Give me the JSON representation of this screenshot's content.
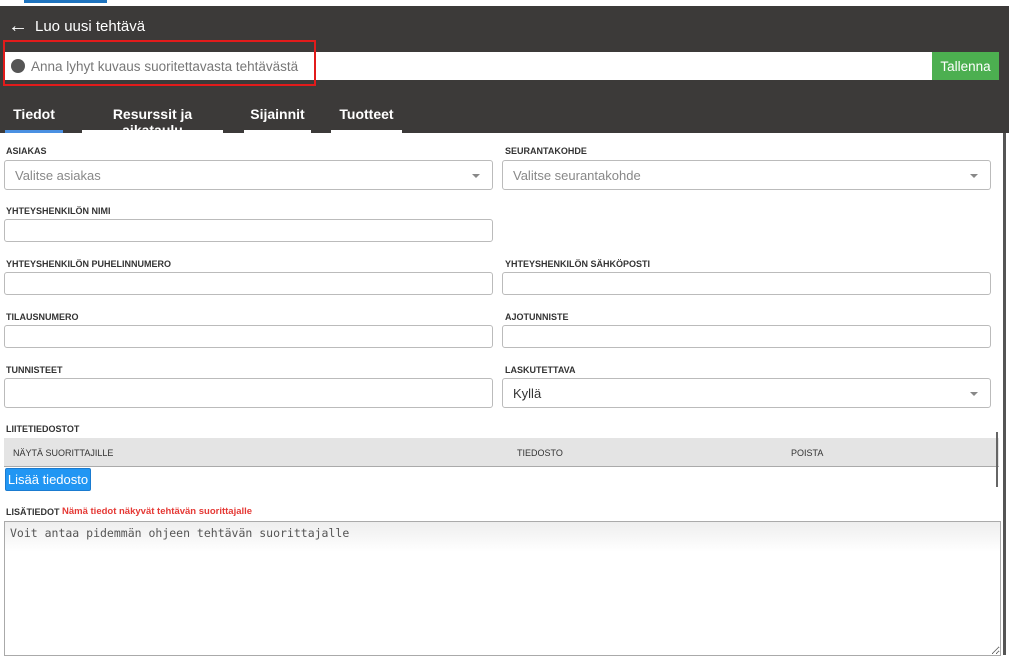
{
  "header": {
    "title": "Luo uusi tehtävä",
    "description_placeholder": "Anna lyhyt kuvaus suoritettavasta tehtävästä",
    "save_label": "Tallenna"
  },
  "tabs": [
    {
      "label": "Tiedot",
      "active": true
    },
    {
      "label": "Resurssit ja aikataulu"
    },
    {
      "label": "Sijainnit"
    },
    {
      "label": "Tuotteet"
    }
  ],
  "form": {
    "customer": {
      "label": "ASIAKAS",
      "placeholder": "Valitse asiakas"
    },
    "tracking": {
      "label": "SEURANTAKOHDE",
      "placeholder": "Valitse seurantakohde"
    },
    "contact_name": {
      "label": "YHTEYSHENKILÖN NIMI"
    },
    "contact_phone": {
      "label": "YHTEYSHENKILÖN PUHELINNUMERO"
    },
    "contact_email": {
      "label": "YHTEYSHENKILÖN SÄHKÖPOSTI"
    },
    "order_number": {
      "label": "TILAUSNUMERO"
    },
    "run_id": {
      "label": "AJOTUNNISTE"
    },
    "tags": {
      "label": "TUNNISTEET"
    },
    "billable": {
      "label": "LASKUTETTAVA",
      "value": "Kyllä"
    }
  },
  "attachments": {
    "label": "LIITETIEDOSTOT",
    "columns": [
      "NÄYTÄ SUORITTAJILLE",
      "TIEDOSTO",
      "POISTA"
    ],
    "add_label": "Lisää tiedosto"
  },
  "notes": {
    "label": "LISÄTIEDOT",
    "warning": "Nämä tiedot näkyvät tehtävän suorittajalle",
    "placeholder": "Voit antaa pidemmän ohjeen tehtävän suorittajalle"
  },
  "colors": {
    "header": "#3c3a39",
    "save": "#4caf50",
    "add": "#2196f3",
    "warning": "#e53935"
  }
}
